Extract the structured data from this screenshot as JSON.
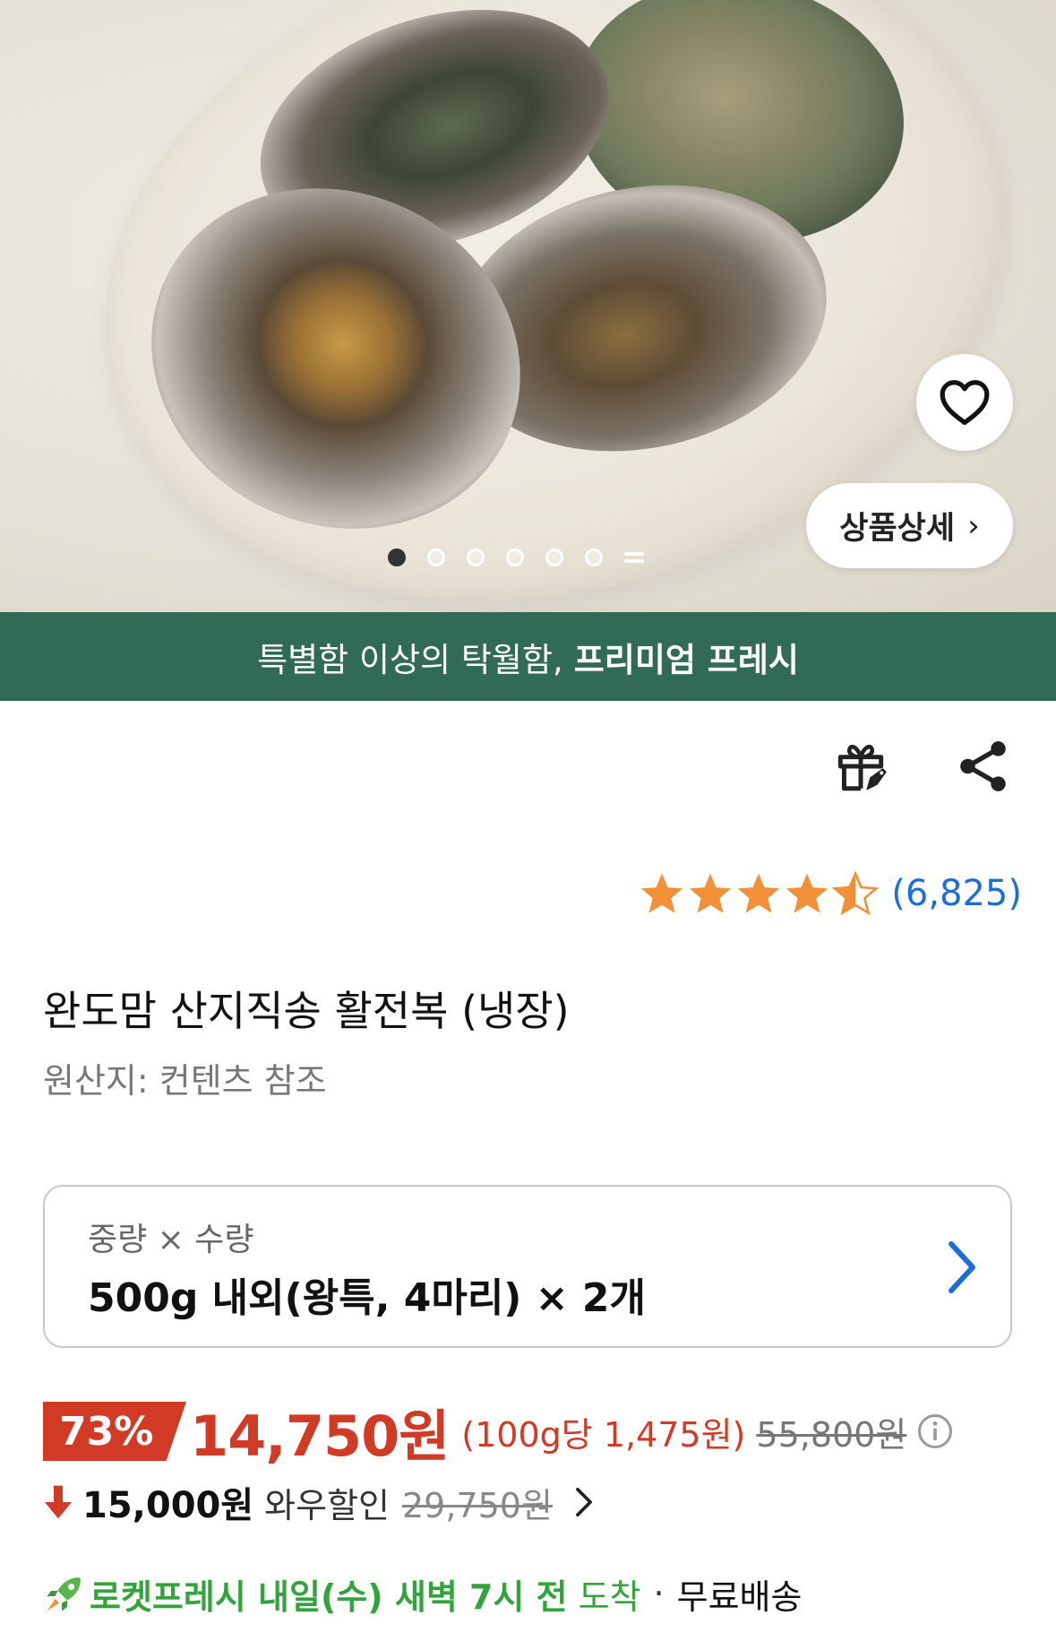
{
  "hero": {
    "detail_button_label": "상품상세",
    "detail_chevron": "›",
    "slide_count": 6,
    "active_slide": 1
  },
  "banner": {
    "text_normal": "특별함 이상의 탁월함,",
    "text_bold": "프리미엄 프레시"
  },
  "rating": {
    "stars": 4.5,
    "count": "(6,825)",
    "star_color": "#f2903a"
  },
  "product": {
    "title": "완도맘 산지직송 활전복 (냉장)",
    "origin": "원산지: 컨텐츠 참조"
  },
  "option": {
    "label": "중량 × 수량",
    "value": "500g 내외(왕특, 4마리) × 2개"
  },
  "price": {
    "discount": "73%",
    "sale_price": "14,750원",
    "unit_price": "(100g당 1,475원)",
    "original_price": "55,800원"
  },
  "wow": {
    "price": "15,000원",
    "label": "와우할인",
    "original_price": "29,750원"
  },
  "delivery": {
    "rocket_label": "로켓프레시 내일(수) 새벽 7시 전",
    "arrive_label": "도착",
    "separator": "·",
    "shipping": "무료배송"
  },
  "icons": {
    "wishlist": "heart-icon",
    "gift": "gift-icon",
    "share": "share-icon",
    "info": "info-icon",
    "rocket": "rocket-icon"
  },
  "colors": {
    "banner": "#316a55",
    "accent_red": "#d13a25",
    "rating_blue": "#1b6ed6",
    "rocket_green": "#33a33c"
  }
}
